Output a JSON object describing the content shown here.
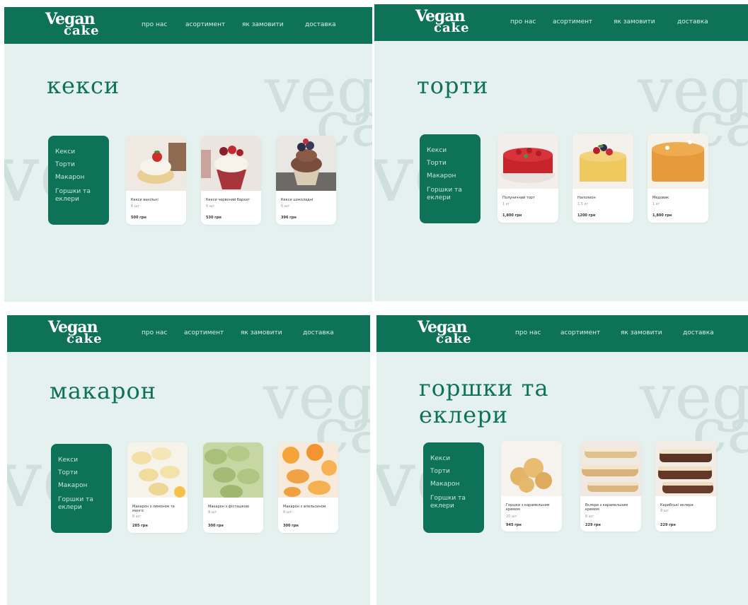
{
  "brand": {
    "line1": "Vegan",
    "line2": "cake"
  },
  "nav": [
    "про нас",
    "асортимент",
    "як замовити",
    "доставка"
  ],
  "watermark": {
    "w1": "veg",
    "w2": "ca",
    "w3": "ve"
  },
  "sidebar": [
    "Кекси",
    "Торти",
    "Макарон",
    "Горшки та еклери"
  ],
  "pages": [
    {
      "title": "кекси",
      "products": [
        {
          "name": "Кекси ванільні",
          "qty": "6 шт",
          "price": "500 грн",
          "icon": "vanilla-cupcake-icon"
        },
        {
          "name": "Кекси червоний бархат",
          "qty": "6 шт",
          "price": "530 грн",
          "icon": "red-velvet-cupcake-icon"
        },
        {
          "name": "Кекси шоколадні",
          "qty": "6 шт",
          "price": "396 грн",
          "icon": "chocolate-cupcake-icon"
        }
      ]
    },
    {
      "title": "торти",
      "products": [
        {
          "name": "Полуничний торт",
          "qty": "1 кг",
          "price": "1,800 грн",
          "icon": "strawberry-cake-icon"
        },
        {
          "name": "Наполеон",
          "qty": "1,5 кг",
          "price": "1200 грн",
          "icon": "napoleon-cake-icon"
        },
        {
          "name": "Медовик",
          "qty": "1 кг",
          "price": "1,800 грн",
          "icon": "honey-cake-icon"
        }
      ]
    },
    {
      "title": "макарон",
      "products": [
        {
          "name": "Макарон з лимоном та манго",
          "qty": "8 шт",
          "price": "285 грн",
          "icon": "lemon-macaron-icon"
        },
        {
          "name": "Макарон з фісташкою",
          "qty": "8 шт",
          "price": "300 грн",
          "icon": "pistachio-macaron-icon"
        },
        {
          "name": "Макарон з апельсином",
          "qty": "8 шт",
          "price": "300 грн",
          "icon": "orange-macaron-icon"
        }
      ]
    },
    {
      "title": "горшки та еклери",
      "products": [
        {
          "name": "Горшки з карамельним кремом",
          "qty": "20 шт",
          "price": "945 грн",
          "icon": "profiterole-icon"
        },
        {
          "name": "Еклери з карамельним кремом",
          "qty": "8 шт",
          "price": "229 грн",
          "icon": "eclair-icon"
        },
        {
          "name": "Карибські еклери",
          "qty": "8 шт",
          "price": "229 грн",
          "icon": "caribbean-eclair-icon"
        }
      ]
    }
  ],
  "colors": {
    "brand_green": "#0e7258",
    "panel_bg": "#e4f1ee",
    "watermark": "#cfe0dc"
  }
}
